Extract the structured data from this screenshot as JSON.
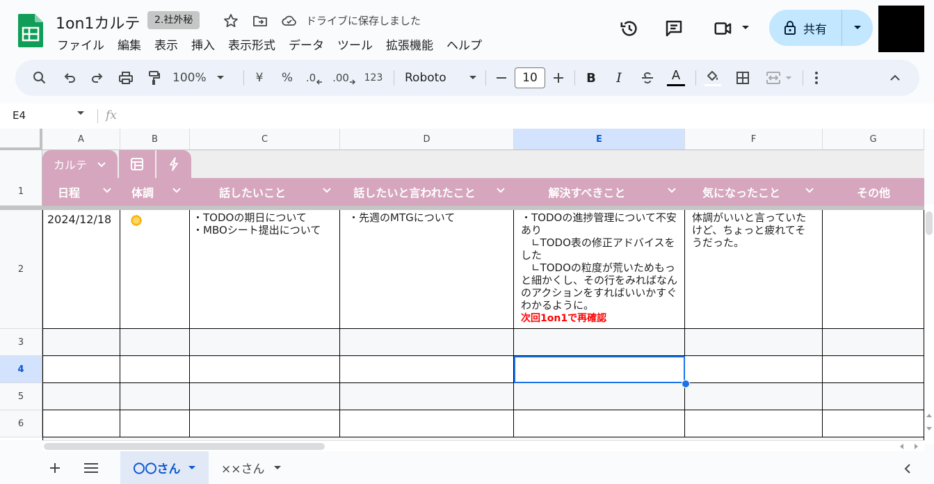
{
  "header": {
    "doc_title": "1on1カルテ",
    "badge": "2.社外秘",
    "saved_status": "ドライブに保存しました",
    "share_label": "共有"
  },
  "menu": [
    "ファイル",
    "編集",
    "表示",
    "挿入",
    "表示形式",
    "データ",
    "ツール",
    "拡張機能",
    "ヘルプ"
  ],
  "toolbar": {
    "zoom": "100%",
    "currency": "¥",
    "percent": "%",
    "dec_decrease": ".0",
    "dec_increase": ".00",
    "number_format": "123",
    "font": "Roboto",
    "font_size": "10",
    "bold": "B",
    "italic": "I",
    "text_color": "A"
  },
  "formula_bar": {
    "name_box": "E4",
    "fx": "fx"
  },
  "columns": [
    "A",
    "B",
    "C",
    "D",
    "E",
    "F",
    "G"
  ],
  "rows": [
    "1",
    "2",
    "3",
    "4",
    "5",
    "6"
  ],
  "chips": {
    "karte": "カルテ"
  },
  "header_row": [
    "日程",
    "体調",
    "話したいこと",
    "話したいと言われたこと",
    "解決すべきこと",
    "気になったこと",
    "その他"
  ],
  "row2": {
    "date": "2024/12/18",
    "talk": "・TODOの期日について\n・MBOシート提出について",
    "requested": "・先週のMTGについて",
    "solve": "・TODOの進捗管理について不安あり\n　∟TODO表の修正アドバイスをした\n　∟TODOの粒度が荒いためもっと細かくし、その行をみればなんのアクションをすればいいかすぐわかるように。",
    "solve_note": "次回1on1で再確認",
    "noticed": "体調がいいと言っていたけど、ちょっと疲れてそうだった。"
  },
  "sheets": {
    "active": "〇〇さん",
    "other": "××さん"
  },
  "colors": {
    "accent": "#d5a6bd",
    "selection": "#1a73e8",
    "note_red": "#ff0000",
    "sun": "#fbbc04"
  }
}
